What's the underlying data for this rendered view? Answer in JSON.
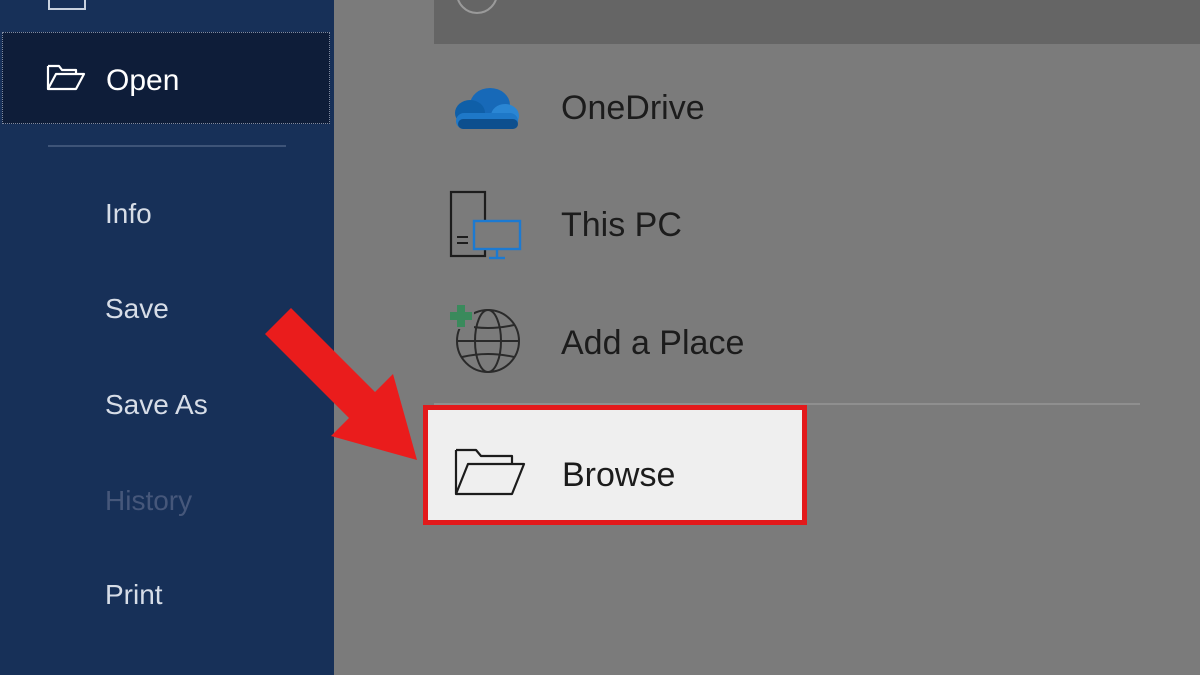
{
  "sidebar": {
    "open_label": "Open",
    "items": [
      {
        "label": "Info",
        "enabled": true
      },
      {
        "label": "Save",
        "enabled": true
      },
      {
        "label": "Save As",
        "enabled": true
      },
      {
        "label": "History",
        "enabled": false
      },
      {
        "label": "Print",
        "enabled": true
      }
    ]
  },
  "places": {
    "onedrive_label": "OneDrive",
    "this_pc_label": "This PC",
    "add_place_label": "Add a Place",
    "browse_label": "Browse"
  },
  "colors": {
    "sidebar_bg": "#173058",
    "selected_bg": "#0e1d39",
    "content_bg": "#7b7b7b",
    "highlight_border": "#e3191b",
    "arrow": "#ea1c1c",
    "onedrive_blue": "#0f5fa8",
    "add_place_green": "#3a8a5c"
  },
  "icons": {
    "open": "folder-open-icon",
    "onedrive": "cloud-icon",
    "this_pc": "computer-icon",
    "add_place": "globe-plus-icon",
    "browse": "folder-open-icon"
  }
}
